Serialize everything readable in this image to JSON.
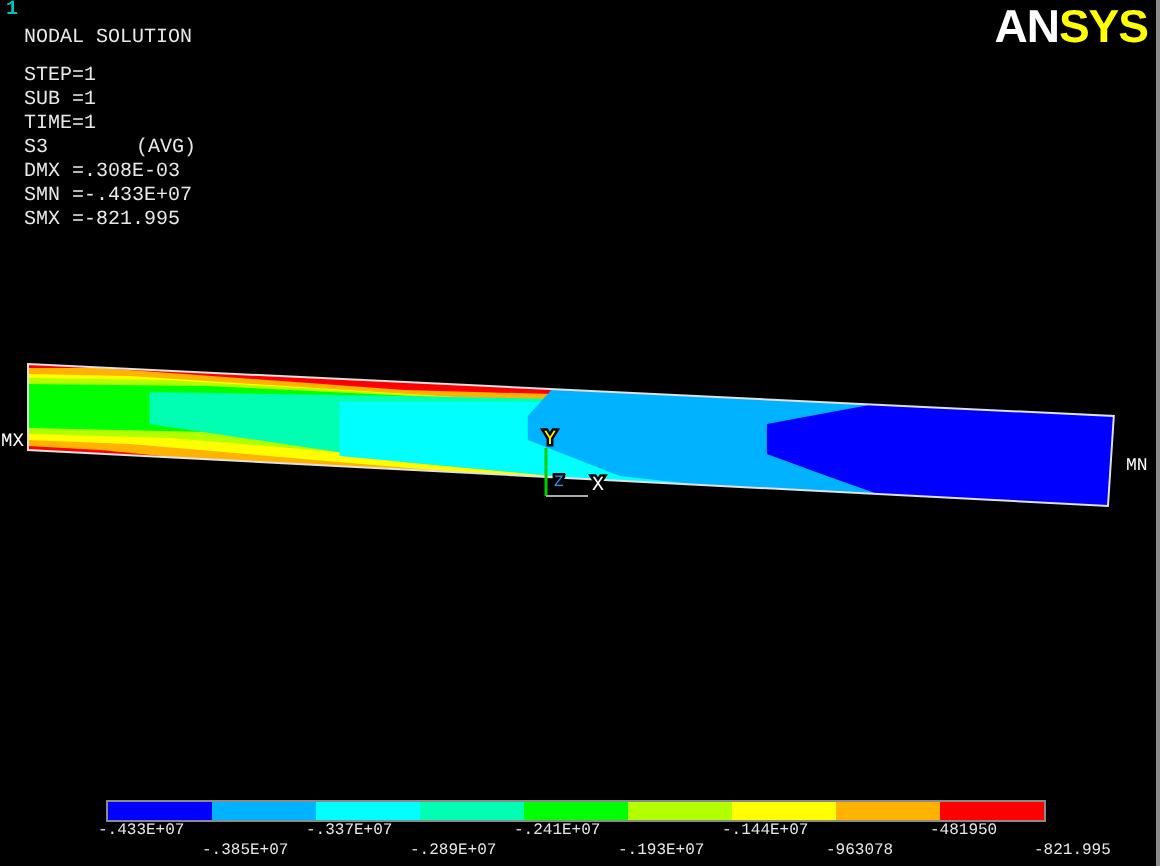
{
  "window": {
    "number": "1"
  },
  "logo": {
    "parts": [
      "AN",
      "SYS"
    ]
  },
  "info": {
    "title": "NODAL SOLUTION",
    "lines": [
      "STEP=1",
      "SUB =1",
      "TIME=1"
    ],
    "component": "S3",
    "averaging": "(AVG)",
    "stats": [
      "DMX =.308E-03",
      "SMN =-.433E+07",
      "SMX =-821.995"
    ]
  },
  "plot": {
    "max_label": "MX",
    "min_label": "MN",
    "axes": {
      "x": "X",
      "y": "Y",
      "z": "Z"
    }
  },
  "legend": {
    "bands": [
      {
        "color": "#0000ff"
      },
      {
        "color": "#00b2ff"
      },
      {
        "color": "#00ffff"
      },
      {
        "color": "#00ffb2"
      },
      {
        "color": "#00ff00"
      },
      {
        "color": "#b2ff00"
      },
      {
        "color": "#ffff00"
      },
      {
        "color": "#ffb200"
      },
      {
        "color": "#ff0000"
      }
    ],
    "labels": [
      "-.433E+07",
      "-.385E+07",
      "-.337E+07",
      "-.289E+07",
      "-.241E+07",
      "-.193E+07",
      "-.144E+07",
      "-963078",
      "-481950",
      "-821.995"
    ]
  }
}
